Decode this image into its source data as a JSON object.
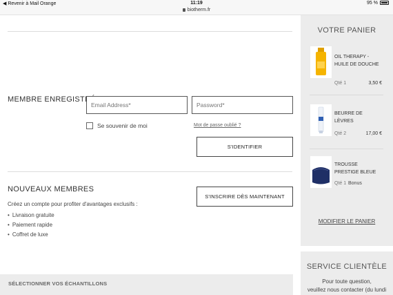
{
  "status_bar": {
    "back_label": "◀ Revenir à Mail Orange",
    "time": "11:19",
    "url": "biotherm.fr",
    "battery": "95 %"
  },
  "login": {
    "title": "MEMBRE ENREGISTRÉ",
    "email_placeholder": "Email Address*",
    "password_placeholder": "Password*",
    "remember_label": "Se souvenir de moi",
    "remember_checked": false,
    "forgot_label": "Mot de passe oublié ?",
    "submit_label": "S'IDENTIFIER"
  },
  "new_members": {
    "title": "NOUVEAUX MEMBRES",
    "register_label": "S'INSCRIRE DÈS MAINTENANT",
    "description": "Créez un compte pour profiter d'avantages exclusifs :",
    "benefits": [
      "Livraison gratuite",
      "Paiement rapide",
      "Coffret de luxe"
    ]
  },
  "samples": {
    "label": "SÉLECTIONNER VOS ÉCHANTILLONS"
  },
  "cart": {
    "title": "VOTRE PANIER",
    "items": [
      {
        "name": "OIL THERAPY - HUILE DE DOUCHE",
        "qty": "Qté 1",
        "price": "3,50 €",
        "icon": "oil-bottle"
      },
      {
        "name": "BEURRE DE LÈVRES",
        "qty": "Qté 2",
        "price": "17,00 €",
        "icon": "lip-balm-tube"
      },
      {
        "name": "TROUSSE PRESTIGE BLEUE",
        "qty": "Qté 1",
        "price": "Bonus",
        "icon": "pouch"
      }
    ],
    "modify_label": "MODIFIER LE PANIER"
  },
  "service": {
    "title": "SERVICE CLIENTÈLE",
    "line1": "Pour toute question,",
    "line2": "veuillez nous contacter (du lundi"
  },
  "colors": {
    "panel_bg": "#ececec",
    "oil_yellow": "#f5b400",
    "pouch_blue": "#1f2f66"
  }
}
